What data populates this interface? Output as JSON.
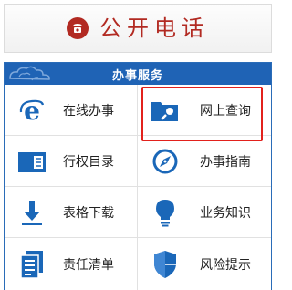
{
  "phone": {
    "title": "公开电话",
    "icon": "telephone-icon"
  },
  "panel": {
    "title": "办事服务"
  },
  "services": [
    {
      "label": "在线办事",
      "icon": "ie-browser-icon"
    },
    {
      "label": "网上查询",
      "icon": "folder-search-icon"
    },
    {
      "label": "行权目录",
      "icon": "directory-book-icon"
    },
    {
      "label": "办事指南",
      "icon": "compass-icon"
    },
    {
      "label": "表格下载",
      "icon": "download-arrow-icon"
    },
    {
      "label": "业务知识",
      "icon": "lightbulb-icon"
    },
    {
      "label": "责任清单",
      "icon": "document-list-icon"
    },
    {
      "label": "风险提示",
      "icon": "shield-icon"
    }
  ],
  "colors": {
    "accent_red": "#b22a22",
    "header_blue": "#1f63b5",
    "icon_blue": "#1a67b8",
    "highlight_red": "#e2211c"
  }
}
